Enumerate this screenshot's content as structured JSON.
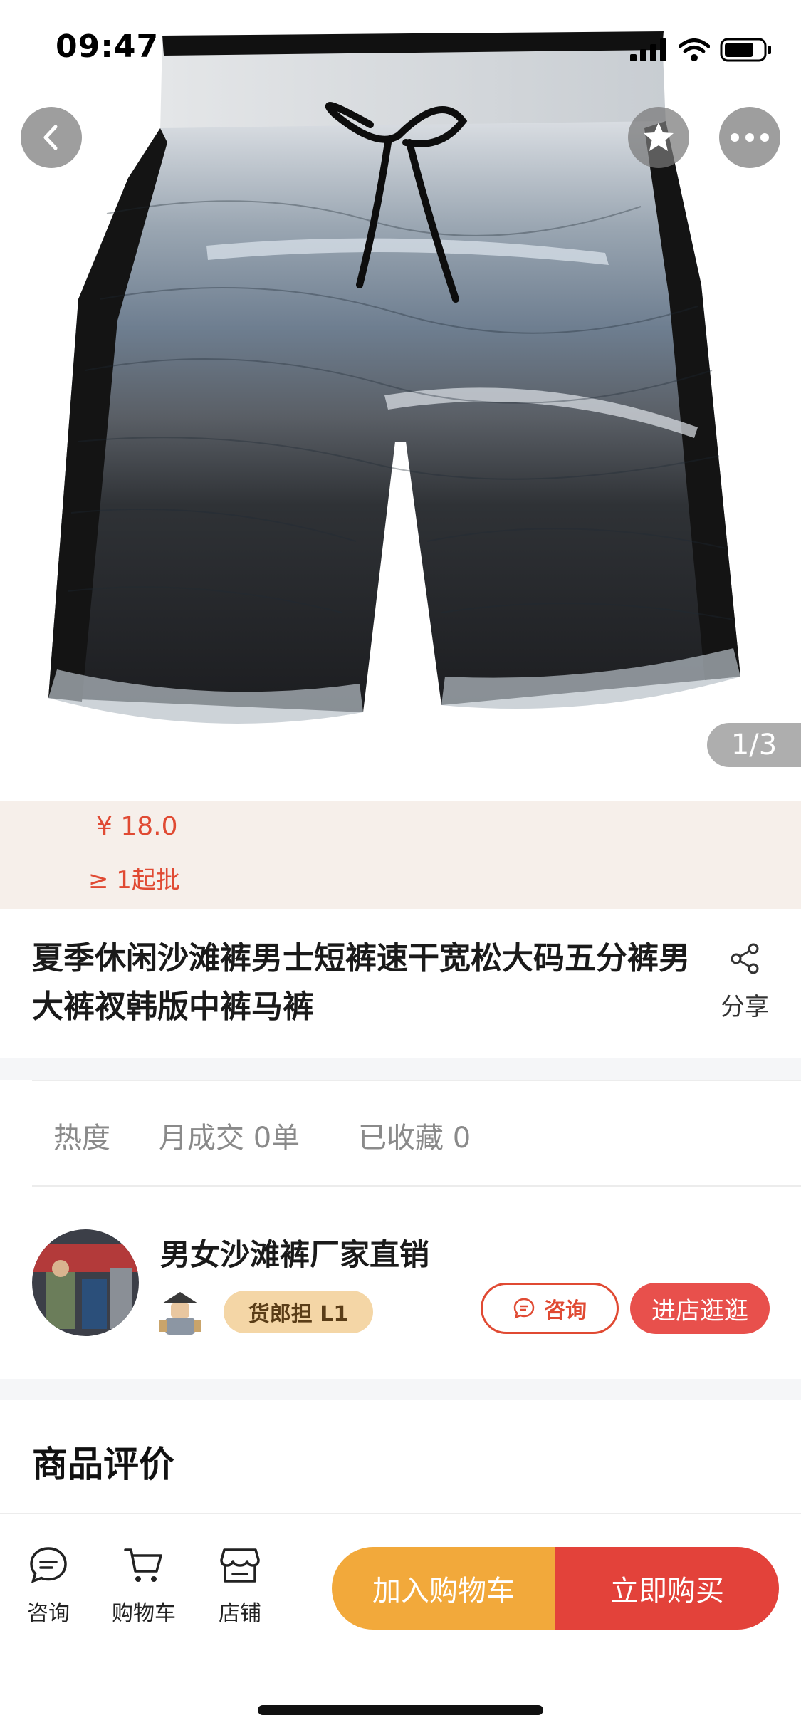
{
  "status_bar": {
    "time": "09:47"
  },
  "product_image": {
    "counter": "1/3",
    "icon": "beach-shorts-photo"
  },
  "nav": {
    "back_icon": "chevron-left-icon",
    "favorite_icon": "star-icon",
    "more_icon": "more-dots-icon"
  },
  "price": {
    "value": "¥ 18.0",
    "min_order": "≥ 1起批",
    "color": "#e04a33"
  },
  "product": {
    "title": "夏季休闲沙滩裤男士短裤速干宽松大码五分裤男大裤衩韩版中裤马裤",
    "share_label": "分享"
  },
  "stats": {
    "heat": "热度",
    "monthly_sales": "月成交 0单",
    "favorites": "已收藏 0"
  },
  "shop": {
    "name": "男女沙滩裤厂家直销",
    "badge": "货郎担 L1",
    "consult_label": "咨询",
    "visit_label": "进店逛逛"
  },
  "reviews": {
    "title": "商品评价"
  },
  "bottom_bar": {
    "tabs": [
      {
        "label": "咨询",
        "icon": "chat-icon"
      },
      {
        "label": "购物车",
        "icon": "cart-icon"
      },
      {
        "label": "店铺",
        "icon": "store-icon"
      }
    ],
    "add_to_cart": "加入购物车",
    "buy_now": "立即购买",
    "add_to_cart_color": "#f2a93b",
    "buy_now_color": "#e3423a"
  }
}
